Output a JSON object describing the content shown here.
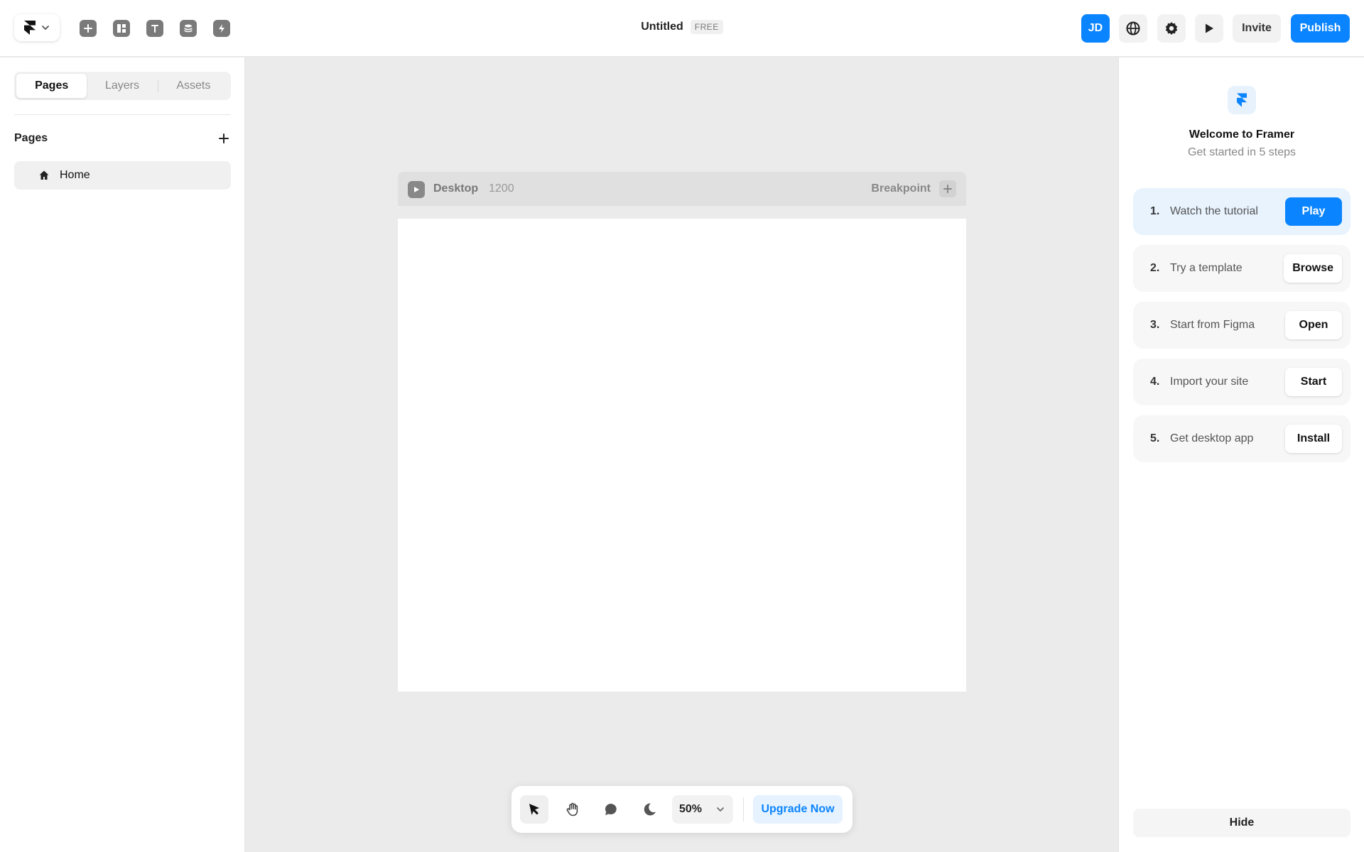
{
  "topbar": {
    "title": "Untitled",
    "plan_badge": "FREE",
    "avatar_initials": "JD",
    "invite_label": "Invite",
    "publish_label": "Publish",
    "icons": [
      "framer-logo-icon",
      "chevron-down-icon",
      "insert-icon",
      "layout-icon",
      "text-icon",
      "cms-icon",
      "interactions-icon",
      "globe-icon",
      "gear-icon",
      "play-icon"
    ]
  },
  "left_panel": {
    "tabs": [
      {
        "label": "Pages",
        "active": true
      },
      {
        "label": "Layers",
        "active": false
      },
      {
        "label": "Assets",
        "active": false
      }
    ],
    "section_title": "Pages",
    "pages": [
      {
        "label": "Home",
        "icon": "home-icon"
      }
    ]
  },
  "canvas": {
    "frame_name": "Desktop",
    "frame_width": "1200",
    "breakpoint_label": "Breakpoint"
  },
  "bottom_toolbar": {
    "zoom": "50%",
    "upgrade_label": "Upgrade Now",
    "tools": [
      "select-icon",
      "hand-icon",
      "comment-icon",
      "dark-mode-icon"
    ]
  },
  "right_panel": {
    "title": "Welcome to Framer",
    "subtitle": "Get started in 5 steps",
    "steps": [
      {
        "num": "1.",
        "label": "Watch the tutorial",
        "button": "Play"
      },
      {
        "num": "2.",
        "label": "Try a template",
        "button": "Browse"
      },
      {
        "num": "3.",
        "label": "Start from Figma",
        "button": "Open"
      },
      {
        "num": "4.",
        "label": "Import your site",
        "button": "Start"
      },
      {
        "num": "5.",
        "label": "Get desktop app",
        "button": "Install"
      }
    ],
    "hide_label": "Hide"
  },
  "colors": {
    "accent": "#0a84ff",
    "canvas_bg": "#ebebeb",
    "panel_bg": "#ffffff"
  }
}
